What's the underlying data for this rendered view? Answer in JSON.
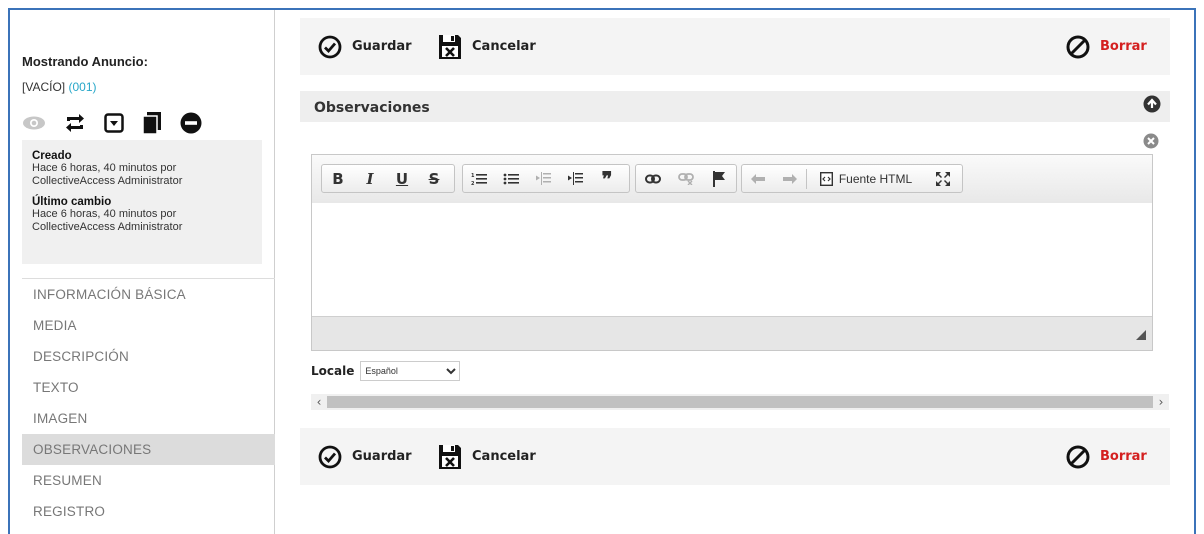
{
  "sidebar": {
    "title": "Mostrando Anuncio:",
    "record_value": "[VACÍO]",
    "record_id": "(001)",
    "icons": [
      "eye-icon",
      "repeat-icon",
      "dropdown-icon",
      "duplicate-icon",
      "remove-icon"
    ],
    "info": {
      "created_label": "Creado",
      "created_text_1": "Hace 6 horas, 40 minutos por",
      "created_text_2": "CollectiveAccess Administrator",
      "changed_label": "Último cambio",
      "changed_text_1": "Hace 6 horas, 40 minutos por",
      "changed_text_2": "CollectiveAccess Administrator"
    },
    "nav": [
      {
        "label": "INFORMACIÓN BÁSICA",
        "active": false
      },
      {
        "label": "MEDIA",
        "active": false
      },
      {
        "label": "DESCRIPCIÓN",
        "active": false
      },
      {
        "label": "TEXTO",
        "active": false
      },
      {
        "label": "IMAGEN",
        "active": false
      },
      {
        "label": "OBSERVACIONES",
        "active": true
      },
      {
        "label": "RESUMEN",
        "active": false
      },
      {
        "label": "REGISTRO",
        "active": false
      }
    ]
  },
  "toolbar": {
    "save_label": "Guardar",
    "cancel_label": "Cancelar",
    "delete_label": "Borrar"
  },
  "panel": {
    "title": "Observaciones",
    "editor_buttons": [
      "B",
      "I",
      "U",
      "S"
    ],
    "source_label": "Fuente HTML"
  },
  "locale": {
    "label": "Locale",
    "selected": "Español"
  },
  "colors": {
    "accent_blue": "#3b73b9",
    "id_teal": "#28a7c9",
    "delete_red": "#d41f1f",
    "active_nav_bg": "#dcdcdc"
  }
}
